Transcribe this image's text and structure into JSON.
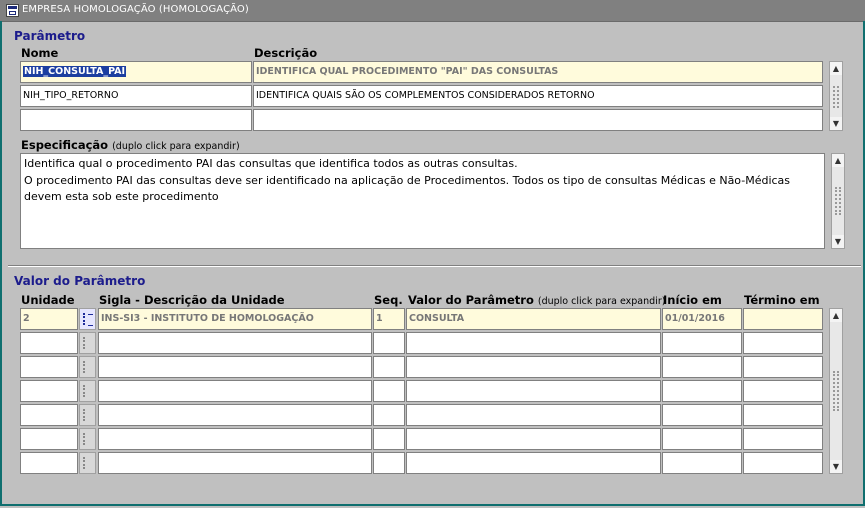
{
  "window": {
    "title": "EMPRESA HOMOLOGAÇÃO (HOMOLOGAÇÃO)"
  },
  "parametro": {
    "section_title": "Parâmetro",
    "col_nome": "Nome",
    "col_descricao": "Descrição",
    "rows": [
      {
        "nome": "NIH_CONSULTA_PAI",
        "descricao": "IDENTIFICA QUAL PROCEDIMENTO \"PAI\" DAS CONSULTAS"
      },
      {
        "nome": "NIH_TIPO_RETORNO",
        "descricao": "IDENTIFICA QUAIS SÃO OS COMPLEMENTOS CONSIDERADOS RETORNO"
      },
      {
        "nome": "",
        "descricao": ""
      }
    ],
    "especificacao_label": "Especificação",
    "especificacao_hint": "(duplo click para expandir)",
    "especificacao_lines": [
      "Identifica qual o procedimento PAI das consultas que identifica todos as outras consultas.",
      "O procedimento PAI das consultas deve ser identificado na aplicação de Procedimentos. Todos os tipo de consultas Médicas e Não-Médicas",
      "devem esta sob este procedimento"
    ]
  },
  "valor": {
    "section_title": "Valor do Parâmetro",
    "col_unidade": "Unidade",
    "col_sigla": "Sigla - Descrição da Unidade",
    "col_seq": "Seq.",
    "col_valor": "Valor do Parâmetro",
    "col_valor_hint": "(duplo click para expandir)",
    "col_inicio": "Início em",
    "col_termino": "Término em",
    "rows": [
      {
        "unidade": "2",
        "sigla": "INS-SI3 - INSTITUTO DE HOMOLOGAÇÃO",
        "seq": "1",
        "valor": "CONSULTA",
        "inicio": "01/01/2016",
        "termino": ""
      },
      {
        "unidade": "",
        "sigla": "",
        "seq": "",
        "valor": "",
        "inicio": "",
        "termino": ""
      },
      {
        "unidade": "",
        "sigla": "",
        "seq": "",
        "valor": "",
        "inicio": "",
        "termino": ""
      },
      {
        "unidade": "",
        "sigla": "",
        "seq": "",
        "valor": "",
        "inicio": "",
        "termino": ""
      },
      {
        "unidade": "",
        "sigla": "",
        "seq": "",
        "valor": "",
        "inicio": "",
        "termino": ""
      },
      {
        "unidade": "",
        "sigla": "",
        "seq": "",
        "valor": "",
        "inicio": "",
        "termino": ""
      },
      {
        "unidade": "",
        "sigla": "",
        "seq": "",
        "valor": "",
        "inicio": "",
        "termino": ""
      }
    ]
  },
  "icons": {
    "window": "form-window-icon",
    "lov": "list-of-values-icon",
    "scroll_up": "arrow-up-icon",
    "scroll_down": "arrow-down-icon"
  },
  "colors": {
    "title_bar": "#808080",
    "section_title": "#1c1c8c",
    "field_current": "#fffbdc",
    "selection": "#1c3ea0",
    "window_border": "#0f6f6f"
  }
}
